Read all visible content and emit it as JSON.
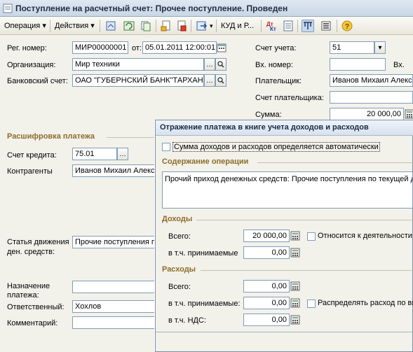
{
  "window": {
    "title": "Поступление на расчетный счет: Прочее поступление. Проведен"
  },
  "toolbar": {
    "operation": "Операция",
    "actions": "Действия",
    "kud": "КУД и Р...",
    "dtkt": "ДтКт"
  },
  "form": {
    "reg_label": "Рег. номер:",
    "reg_value": "МИР00000001",
    "from_label": "от:",
    "date_value": "05.01.2011 12:00:01",
    "org_label": "Организация:",
    "org_value": "Мир техники",
    "bank_label": "Банковский счет:",
    "bank_value": "ОАО \"ГУБЕРНСКИЙ БАНК\"ТАРХАН",
    "account_label": "Счет учета:",
    "account_value": "51",
    "in_number_label": "Вх. номер:",
    "in_number_value": "",
    "in_date_label": "Вх.",
    "payer_label": "Плательщик:",
    "payer_value": "Иванов Михаил Алекса",
    "payer_account_label": "Счет плательщика:",
    "payer_account_value": "",
    "sum_label": "Сумма:",
    "sum_value": "20 000,00",
    "breakdown_header": "Расшифровка платежа",
    "credit_label": "Счет кредита:",
    "credit_value": "75.01",
    "counterparty_label": "Контрагенты",
    "counterparty_value": "Иванов Михаил Алекс",
    "cashflow_label_1": "Статья движения",
    "cashflow_label_2": "ден. средств:",
    "cashflow_value": "Прочие поступления п",
    "purpose_label_1": "Назначение",
    "purpose_label_2": "платежа:",
    "purpose_value": "",
    "responsible_label": "Ответственный:",
    "responsible_value": "Хохлов",
    "comment_label": "Комментарий:",
    "comment_value": ""
  },
  "dialog": {
    "title": "Отражение платежа в книге учета доходов и расходов",
    "auto_checkbox_label": "Сумма доходов и расходов определяется автоматически",
    "content_header": "Содержание операции",
    "content_text": "Прочий приход денежных средств: Прочие поступления по текущей де",
    "income_header": "Доходы",
    "income_total_label": "Всего:",
    "income_total_value": "20 000,00",
    "income_accepted_label": "в т.ч. принимаемые",
    "income_accepted_value": "0,00",
    "income_activity_label": "Относится к деятельности",
    "expense_header": "Расходы",
    "expense_total_label": "Всего:",
    "expense_total_value": "0,00",
    "expense_accepted_label": "в т.ч. принимаемые:",
    "expense_accepted_value": "0,00",
    "expense_vat_label": "в т.ч. НДС:",
    "expense_vat_value": "0,00",
    "expense_distribute_label": "Распределять расход по ви"
  }
}
